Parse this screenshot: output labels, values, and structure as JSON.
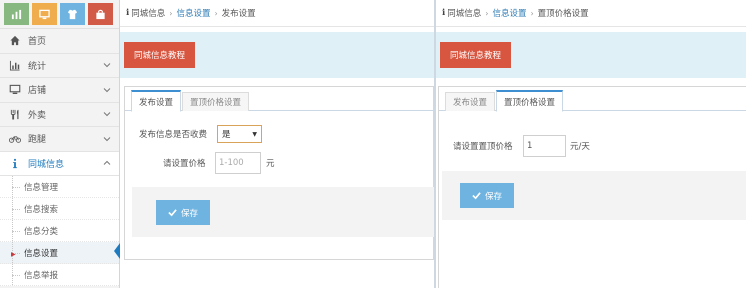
{
  "colors": {
    "accent": "#1f7bbf",
    "danger": "#d8553f",
    "banner": "#dff0f7",
    "save": "#6fb3e0"
  },
  "shortcuts": [
    {
      "icon": "bar-chart-icon",
      "color": "#87b87f"
    },
    {
      "icon": "desktop-icon",
      "color": "#f0ad4e"
    },
    {
      "icon": "shirt-icon",
      "color": "#6fb3e0"
    },
    {
      "icon": "bag-icon",
      "color": "#d15b47"
    }
  ],
  "sidebar": {
    "items": [
      {
        "label": "首页",
        "icon": "home-icon"
      },
      {
        "label": "统计",
        "icon": "bar-chart-icon"
      },
      {
        "label": "店铺",
        "icon": "monitor-icon"
      },
      {
        "label": "外卖",
        "icon": "utensils-icon"
      },
      {
        "label": "跑腿",
        "icon": "bicycle-icon"
      },
      {
        "label": "同城信息",
        "icon": "info-icon"
      }
    ],
    "sub_items": [
      {
        "label": "信息管理"
      },
      {
        "label": "信息搜索"
      },
      {
        "label": "信息分类"
      },
      {
        "label": "信息设置"
      },
      {
        "label": "信息举报"
      }
    ]
  },
  "left_pane": {
    "breadcrumb": {
      "home": "同城信息",
      "link": "信息设置",
      "current": "发布设置"
    },
    "tutorial_button": "同城信息教程",
    "tabs": [
      {
        "label": "发布设置"
      },
      {
        "label": "置顶价格设置"
      }
    ],
    "form": {
      "charge_label": "发布信息是否收费",
      "charge_value": "是",
      "price_label": "请设置价格",
      "price_placeholder": "1-100",
      "price_unit": "元"
    },
    "save_label": "保存"
  },
  "right_pane": {
    "breadcrumb": {
      "home": "同城信息",
      "link": "信息设置",
      "current": "置顶价格设置"
    },
    "tutorial_button": "同城信息教程",
    "tabs": [
      {
        "label": "发布设置"
      },
      {
        "label": "置顶价格设置"
      }
    ],
    "form": {
      "top_price_label": "请设置置顶价格",
      "top_price_value": "1",
      "top_price_unit": "元/天"
    },
    "save_label": "保存"
  }
}
